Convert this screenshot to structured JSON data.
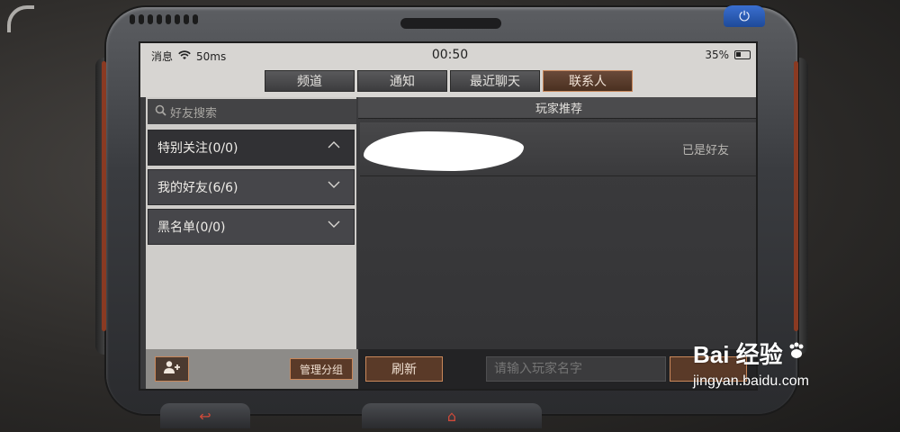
{
  "status_bar": {
    "left_label": "消息",
    "ping": "50ms",
    "time": "00:50",
    "battery": "35%"
  },
  "tabs": [
    {
      "label": "频道"
    },
    {
      "label": "通知"
    },
    {
      "label": "最近聊天"
    },
    {
      "label": "联系人",
      "active": true
    }
  ],
  "sidebar": {
    "search_placeholder": "好友搜索",
    "groups": [
      {
        "label": "特别关注(0/0)",
        "active": true
      },
      {
        "label": "我的好友(6/6)"
      },
      {
        "label": "黑名单(0/0)"
      }
    ],
    "manage_label": "管理分组"
  },
  "main": {
    "header": "玩家推荐",
    "players": [
      {
        "status": "已是好友"
      }
    ],
    "refresh_label": "刷新",
    "input_placeholder": "请输入玩家名字"
  },
  "watermark": {
    "brand": "Bai 经验",
    "url": "jingyan.baidu.com"
  },
  "colors": {
    "accent_border": "#c9875a",
    "button_bg": "#5a3a28",
    "power_button": "#2d5fbd"
  }
}
